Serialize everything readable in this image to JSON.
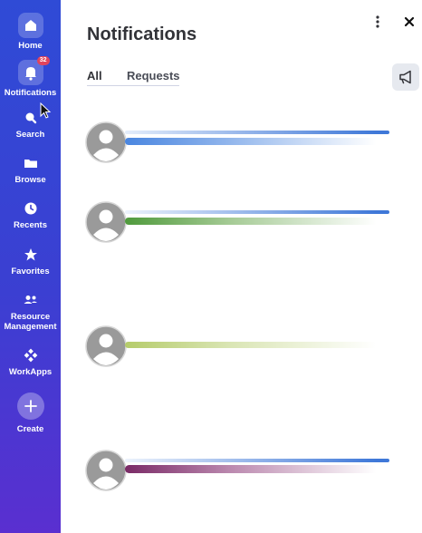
{
  "nav": {
    "home": "Home",
    "notifications": "Notifications",
    "notifications_badge": "32",
    "search": "Search",
    "browse": "Browse",
    "recents": "Recents",
    "favorites": "Favorites",
    "resource_line1": "Resource",
    "resource_line2": "Management",
    "workapps": "WorkApps",
    "create": "Create"
  },
  "panel": {
    "title": "Notifications",
    "tabs": [
      "All",
      "Requests"
    ]
  },
  "colors": {
    "rail_top": "#2f4bd6",
    "rail_bottom": "#5a2fd0",
    "notif_1": "#4a86e0",
    "notif_2": "#6aa84f",
    "notif_3": "#b5cc6a",
    "notif_4": "#8e3b7a"
  },
  "icons": [
    "home-icon",
    "bell-icon",
    "search-icon",
    "folder-icon",
    "clock-icon",
    "star-icon",
    "people-icon",
    "workapps-icon",
    "plus-icon",
    "more-vertical-icon",
    "close-icon",
    "megaphone-icon",
    "avatar-icon"
  ]
}
